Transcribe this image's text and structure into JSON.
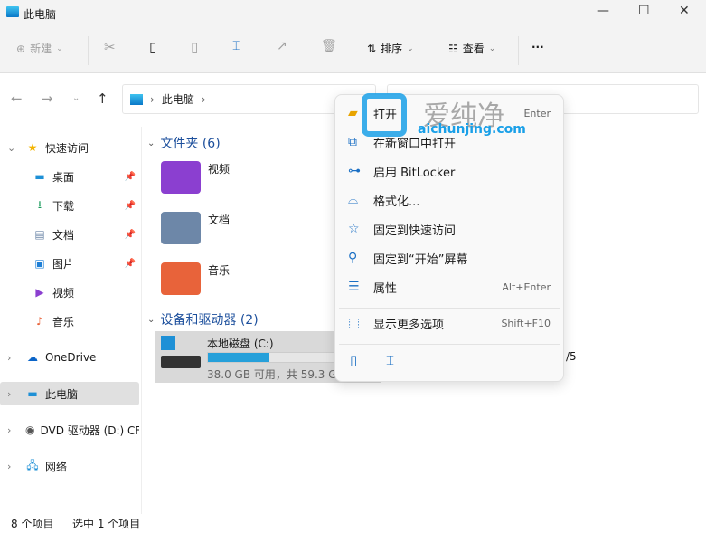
{
  "window": {
    "title": "此电脑",
    "minimize": "—",
    "maximize": "☐",
    "close": "✕"
  },
  "toolbar": {
    "new": "新建",
    "sort": "排序",
    "view": "查看",
    "more": "···"
  },
  "address": {
    "location": "此电脑"
  },
  "sidebar": {
    "items": [
      {
        "label": "快速访问",
        "icon": "star-icon"
      },
      {
        "label": "桌面",
        "icon": "desktop-icon",
        "pinned": true
      },
      {
        "label": "下载",
        "icon": "download-icon",
        "pinned": true
      },
      {
        "label": "文档",
        "icon": "document-icon",
        "pinned": true
      },
      {
        "label": "图片",
        "icon": "picture-icon",
        "pinned": true
      },
      {
        "label": "视频",
        "icon": "video-icon"
      },
      {
        "label": "音乐",
        "icon": "music-icon"
      },
      {
        "label": "OneDrive",
        "icon": "cloud-icon"
      },
      {
        "label": "此电脑",
        "icon": "computer-icon",
        "selected": true
      },
      {
        "label": "DVD 驱动器 (D:) CF",
        "icon": "dvd-icon"
      },
      {
        "label": "网络",
        "icon": "network-icon"
      }
    ]
  },
  "main": {
    "folders_header": "文件夹 (6)",
    "folders": [
      {
        "name": "视频",
        "color": "#8b3fd0"
      },
      {
        "name": "文档",
        "color": "#6d87a8"
      },
      {
        "name": "音乐",
        "color": "#e8633a"
      }
    ],
    "devices_header": "设备和驱动器 (2)",
    "drive": {
      "name": "本地磁盘 (C:)",
      "info": "38.0 GB 可用，共 59.3 GB",
      "used_fraction": 0.36,
      "bar_color": "#26a0da"
    },
    "partial_text": "/5"
  },
  "context_menu": {
    "items": [
      {
        "label": "打开",
        "shortcut": "Enter",
        "icon": "folder-open-icon"
      },
      {
        "label": "在新窗口中打开",
        "icon": "open-new-window-icon"
      },
      {
        "label": "启用 BitLocker",
        "icon": "bitlocker-icon"
      },
      {
        "label": "格式化...",
        "icon": "format-icon"
      },
      {
        "label": "固定到快速访问",
        "icon": "star-icon"
      },
      {
        "label": "固定到“开始”屏幕",
        "icon": "pin-icon"
      },
      {
        "label": "属性",
        "shortcut": "Alt+Enter",
        "icon": "properties-icon"
      },
      {
        "label": "显示更多选项",
        "shortcut": "Shift+F10",
        "icon": "more-options-icon"
      }
    ]
  },
  "watermark": {
    "text": "爱纯净",
    "url": "aichunjing.com"
  },
  "status": {
    "count": "8 个项目",
    "selected": "选中 1 个项目"
  }
}
